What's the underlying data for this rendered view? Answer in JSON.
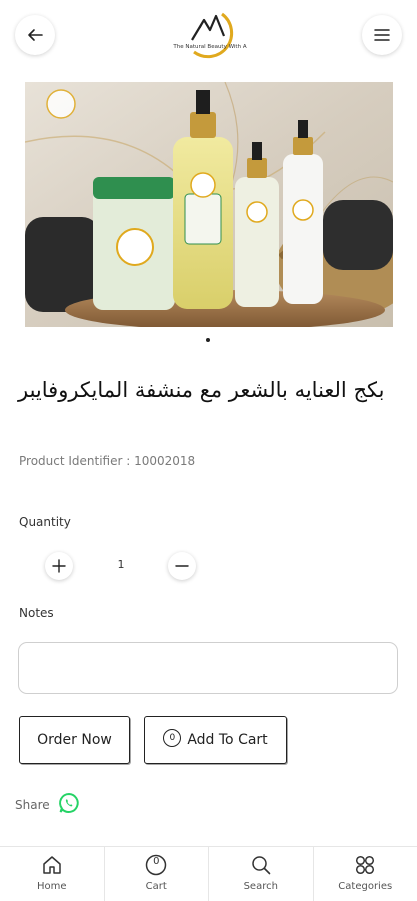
{
  "header": {
    "logo_text": "The Natural Beauty With A"
  },
  "product": {
    "title": "بكج العنايه بالشعر مع منشفة المايكروفايبر",
    "identifier": "Product Identifier : 10002018"
  },
  "quantity": {
    "label": "Quantity",
    "value": "1"
  },
  "notes": {
    "label": "Notes",
    "placeholder": ""
  },
  "actions": {
    "order_now": "Order Now",
    "add_to_cart": "Add To Cart",
    "cart_count": "0"
  },
  "share": {
    "label": "Share"
  },
  "bottom_nav": {
    "items": [
      {
        "label": "Home",
        "icon": "home-icon"
      },
      {
        "label": "Cart",
        "icon": "cart-icon",
        "badge": "0"
      },
      {
        "label": "Search",
        "icon": "search-icon"
      },
      {
        "label": "Categories",
        "icon": "categories-icon"
      }
    ]
  },
  "colors": {
    "accent_gold": "#e0a91e",
    "whatsapp_green": "#25d366",
    "text_dark": "#111111",
    "text_muted": "#7a7a7a"
  }
}
